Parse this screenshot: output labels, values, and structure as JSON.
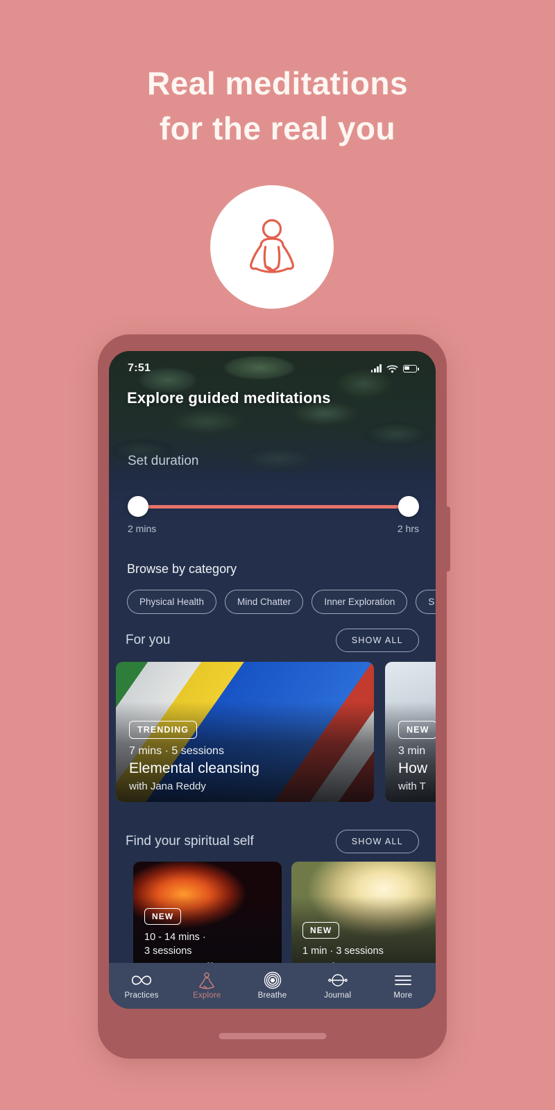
{
  "theme": {
    "background": "#e0918f",
    "frame": "#a85b5c",
    "screen_bg": "#24304b",
    "accent_coral": "#e8736a",
    "nav_bar": "#3c4761",
    "active_nav": "#c77f7d"
  },
  "marketing": {
    "headline_line1": "Real meditations",
    "headline_line2": "for the real you",
    "logo_icon": "meditation-lotus-icon"
  },
  "phone": {
    "status_bar": {
      "time": "7:51",
      "signal_icon": "cellular-signal-icon",
      "wifi_icon": "wifi-icon",
      "battery_icon": "battery-icon"
    },
    "app_title": "Explore guided meditations",
    "duration": {
      "label": "Set duration",
      "min_label": "2 mins",
      "max_label": "2 hrs"
    },
    "browse": {
      "title": "Browse by category",
      "chips": [
        {
          "label": "Physical Health"
        },
        {
          "label": "Mind Chatter"
        },
        {
          "label": "Inner Exploration"
        },
        {
          "label": "S"
        }
      ]
    },
    "for_you": {
      "title": "For you",
      "show_all": "SHOW ALL",
      "cards": [
        {
          "badge": "TRENDING",
          "meta": "7 mins  · 5 sessions",
          "title": "Elemental cleansing",
          "author": "with Jana Reddy"
        },
        {
          "badge": "NEW",
          "meta": "3 min",
          "title": "How",
          "author": "with T"
        }
      ]
    },
    "spiritual": {
      "title": "Find your spiritual self",
      "show_all": "SHOW ALL",
      "cards": [
        {
          "badge": "NEW",
          "meta": "10 - 14 mins  ·\n3 sessions",
          "title": "Mantra sadhana"
        },
        {
          "badge": "NEW",
          "meta": "1 min  · 3 sessions",
          "title": "Just be"
        }
      ]
    },
    "bottom_nav": [
      {
        "label": "Practices",
        "icon": "infinity-icon",
        "active": false
      },
      {
        "label": "Explore",
        "icon": "meditation-figure-icon",
        "active": true
      },
      {
        "label": "Breathe",
        "icon": "concentric-circles-icon",
        "active": false
      },
      {
        "label": "Journal",
        "icon": "orbit-circle-icon",
        "active": false
      },
      {
        "label": "More",
        "icon": "hamburger-menu-icon",
        "active": false
      }
    ]
  }
}
